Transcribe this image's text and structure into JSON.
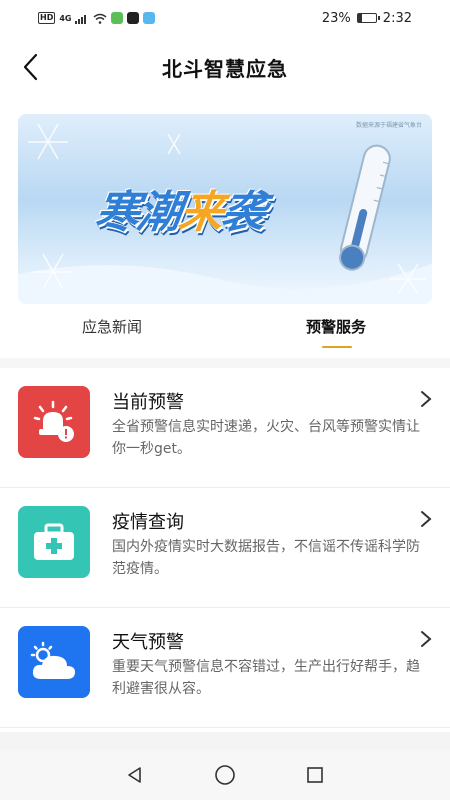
{
  "status_bar": {
    "network_badge": "HD",
    "network_type": "4G",
    "battery_percent": "23%",
    "battery_level": 0.23,
    "time": "2:32"
  },
  "header": {
    "title": "北斗智慧应急",
    "back_icon": "chevron-left-icon"
  },
  "banner": {
    "caption": "数据来源于福建省气象台",
    "title_part1": "寒潮",
    "title_highlight": "来",
    "title_part2": "袭"
  },
  "tabs": [
    {
      "label": "应急新闻",
      "active": false
    },
    {
      "label": "预警服务",
      "active": true
    }
  ],
  "colors": {
    "accent": "#e0a21f",
    "current_warning": "#e34444",
    "epidemic": "#34c5b4",
    "weather": "#1f74f0"
  },
  "services": [
    {
      "title": "当前预警",
      "desc": "全省预警信息实时速递，火灾、台风等预警实情让你一秒get。",
      "icon": "alarm-siren-icon"
    },
    {
      "title": "疫情查询",
      "desc": "国内外疫情实时大数据报告，不信谣不传谣科学防范疫情。",
      "icon": "medical-kit-icon"
    },
    {
      "title": "天气预警",
      "desc": "重要天气预警信息不容错过，生产出行好帮手，趋利避害很从容。",
      "icon": "weather-cloud-icon"
    }
  ],
  "nav": {
    "back": "back-triangle-icon",
    "home": "home-circle-icon",
    "recent": "recent-square-icon"
  }
}
